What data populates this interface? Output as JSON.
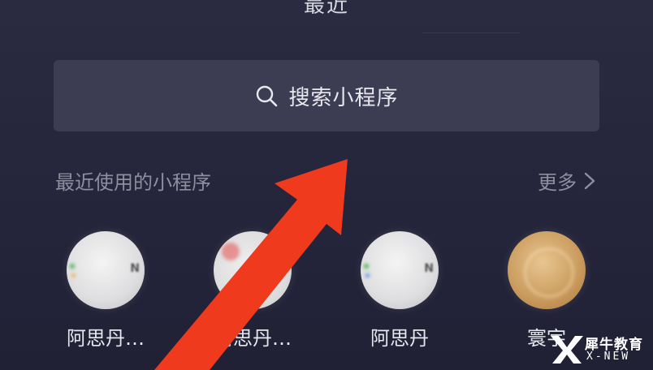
{
  "header": {
    "title": "最近"
  },
  "search": {
    "label": "搜索小程序",
    "icon": "search-icon"
  },
  "recent": {
    "title": "最近使用的小程序",
    "more_label": "更多",
    "more_icon": "chevron-right-icon"
  },
  "apps": [
    {
      "label": "阿思丹…",
      "style": "white"
    },
    {
      "label": "阿思丹…",
      "style": "color"
    },
    {
      "label": "阿思丹",
      "style": "white"
    },
    {
      "label": "寰宇",
      "style": "gold"
    }
  ],
  "colors": {
    "background": "#262639",
    "search_bg": "#3c3c52",
    "arrow": "#f03a1e",
    "text_muted": "#8e8e9e"
  },
  "watermark": {
    "name": "犀牛教育",
    "brand": "X-NEW"
  }
}
